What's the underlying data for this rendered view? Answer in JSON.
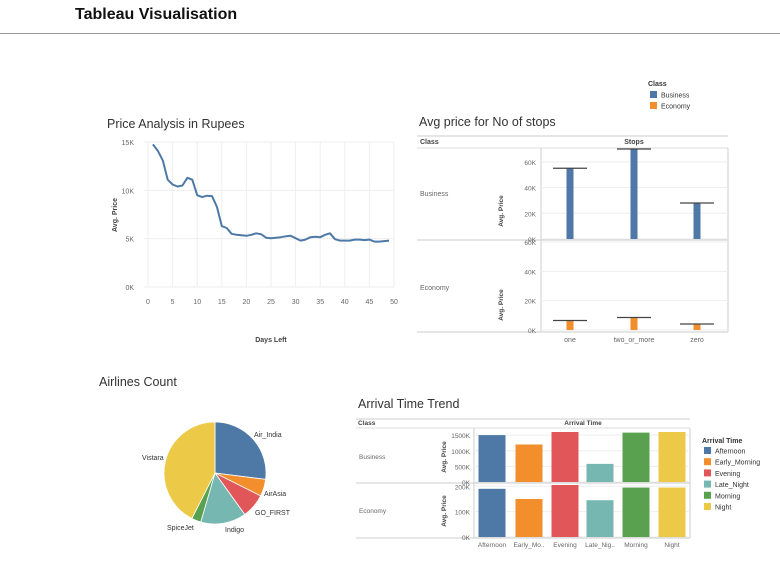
{
  "page": {
    "title": "Tableau Visualisation"
  },
  "chart_data": [
    {
      "id": "price-analysis",
      "type": "line",
      "title": "Price Analysis in Rupees",
      "xlabel": "Days Left",
      "ylabel": "Avg. Price",
      "xlim": [
        0,
        50
      ],
      "ylim": [
        0,
        15000
      ],
      "x_ticks": [
        0,
        5,
        10,
        15,
        20,
        25,
        30,
        35,
        40,
        45,
        50
      ],
      "x_tick_labels": [
        "0",
        "5",
        "10",
        "15",
        "20",
        "25",
        "30",
        "35",
        "40",
        "45",
        "50"
      ],
      "y_ticks": [
        0,
        5000,
        10000,
        15000
      ],
      "y_tick_labels": [
        "0K",
        "5K",
        "10K",
        "15K"
      ],
      "grid": true,
      "series": [
        {
          "color": "#4e79a7",
          "x": [
            1,
            2,
            3,
            4,
            5,
            6,
            7,
            8,
            9,
            10,
            11,
            12,
            13,
            14,
            15,
            16,
            17,
            18,
            19,
            20,
            21,
            22,
            23,
            24,
            25,
            26,
            27,
            28,
            29,
            30,
            31,
            32,
            33,
            34,
            35,
            36,
            37,
            38,
            39,
            40,
            41,
            42,
            43,
            44,
            45,
            46,
            47,
            48,
            49
          ],
          "y": [
            14750,
            14100,
            13100,
            11100,
            10600,
            10400,
            10500,
            11300,
            11100,
            9500,
            9300,
            9450,
            9400,
            8300,
            6300,
            6100,
            5500,
            5400,
            5350,
            5300,
            5400,
            5550,
            5450,
            5100,
            5050,
            5100,
            5150,
            5250,
            5300,
            5050,
            4800,
            4900,
            5150,
            5200,
            5150,
            5400,
            5550,
            4950,
            4800,
            4800,
            4800,
            4900,
            4900,
            4850,
            4900,
            4700,
            4700,
            4750,
            4800
          ]
        }
      ]
    },
    {
      "id": "stops-price",
      "type": "bar",
      "title": "Avg price for No of stops",
      "row_header": "Class",
      "column_header": "Stops",
      "categories": [
        "one",
        "two_or_more",
        "zero"
      ],
      "ylabel": "Avg. Price",
      "legend": {
        "title": "Class",
        "placement": "top-right",
        "items": [
          {
            "name": "Business",
            "color": "#4e79a7"
          },
          {
            "name": "Economy",
            "color": "#f28e2b"
          }
        ]
      },
      "panels": [
        {
          "name": "Business",
          "color": "#4e79a7",
          "values": [
            55000,
            71000,
            28000
          ],
          "ylim": [
            0,
            70000
          ],
          "y_ticks": [
            0,
            20000,
            40000,
            60000
          ],
          "y_tick_labels": [
            "0K",
            "20K",
            "40K",
            "60K"
          ]
        },
        {
          "name": "Economy",
          "color": "#f28e2b",
          "values": [
            6500,
            8500,
            4100
          ],
          "ylim": [
            0,
            60000
          ],
          "y_ticks": [
            0,
            20000,
            40000,
            60000
          ],
          "y_tick_labels": [
            "0K",
            "20K",
            "40K",
            "60K"
          ]
        }
      ]
    },
    {
      "id": "airlines-count",
      "type": "pie",
      "title": "Airlines Count",
      "slices": [
        {
          "label": "Air_India",
          "value": 27,
          "color": "#4e79a7"
        },
        {
          "label": "AirAsia",
          "value": 5.4,
          "color": "#f28e2b"
        },
        {
          "label": "GO_FIRST",
          "value": 7.7,
          "color": "#e15759"
        },
        {
          "label": "Indigo",
          "value": 14.4,
          "color": "#76b7b2"
        },
        {
          "label": "SpiceJet",
          "value": 3,
          "color": "#59a14f"
        },
        {
          "label": "Vistara",
          "value": 42.5,
          "color": "#edc948"
        }
      ]
    },
    {
      "id": "arrival-time",
      "type": "bar",
      "title": "Arrival Time Trend",
      "row_header": "Class",
      "column_header": "Arrival Time",
      "categories": [
        "Afternoon",
        "Early_Morning",
        "Evening",
        "Late_Night",
        "Morning",
        "Night"
      ],
      "category_labels": [
        "Afternoon",
        "Early_Mo..",
        "Evening",
        "Late_Nig..",
        "Morning",
        "Night"
      ],
      "ylabel": "Avg. Price",
      "legend": {
        "title": "Arrival Time",
        "placement": "right",
        "items": [
          {
            "name": "Afternoon",
            "color": "#4e79a7"
          },
          {
            "name": "Early_Morning",
            "color": "#f28e2b"
          },
          {
            "name": "Evening",
            "color": "#e15759"
          },
          {
            "name": "Late_Night",
            "color": "#76b7b2"
          },
          {
            "name": "Morning",
            "color": "#59a14f"
          },
          {
            "name": "Night",
            "color": "#edc948"
          }
        ]
      },
      "panels": [
        {
          "name": "Business",
          "values": [
            1500000,
            1200000,
            1600000,
            580000,
            1580000,
            1600000
          ],
          "ylim": [
            0,
            1600000
          ],
          "y_ticks": [
            0,
            500000,
            1000000,
            1500000
          ],
          "y_tick_labels": [
            "0K",
            "500K",
            "1000K",
            "1500K"
          ]
        },
        {
          "name": "Economy",
          "values": [
            190000,
            150000,
            205000,
            145000,
            195000,
            195000
          ],
          "ylim": [
            0,
            205000
          ],
          "y_ticks": [
            0,
            100000,
            200000
          ],
          "y_tick_labels": [
            "0K",
            "100K",
            "200K"
          ]
        }
      ]
    }
  ]
}
